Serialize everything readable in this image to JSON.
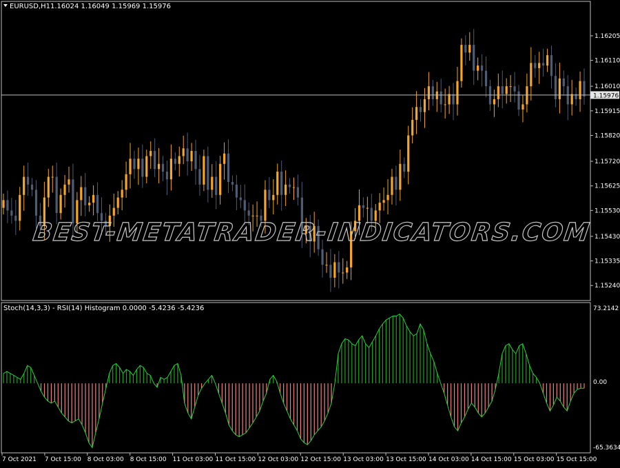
{
  "main_chart": {
    "symbol_label": "EURUSD,H1",
    "ohlc_label": "1.16024 1.16049 1.15969 1.15976",
    "current_price_label": "1.15976",
    "current_price": 1.15976,
    "price_min": 1.1519,
    "price_max": 1.1633,
    "price_ticks": [
      "1.16205",
      "1.16110",
      "1.16010",
      "1.15915",
      "1.15820",
      "1.15720",
      "1.15625",
      "1.15530",
      "1.15430",
      "1.15335",
      "1.15240"
    ]
  },
  "indicator": {
    "title": "Stoch(14,3,3) - RSI(14) Histogram 0.0000 -5.4236 -5.4236",
    "max_label": "73.2142",
    "zero_label": "0.00",
    "min_label": "-65.3634",
    "range_max": 73.2142,
    "range_min": -65.3634
  },
  "time_axis": {
    "labels": [
      "7 Oct 2021",
      "7 Oct 15:00",
      "8 Oct 03:00",
      "8 Oct 15:00",
      "11 Oct 03:00",
      "11 Oct 15:00",
      "12 Oct 03:00",
      "12 Oct 15:00",
      "13 Oct 03:00",
      "13 Oct 15:00",
      "14 Oct 03:00",
      "14 Oct 15:00",
      "15 Oct 03:00",
      "15 Oct 15:00"
    ]
  },
  "watermark": "BEST-METATRADER-INDICATORS.COM",
  "colors": {
    "bull_candle": "#f5a623",
    "bear_candle": "#4e5d73",
    "positive_hist": "#1fa11f",
    "negative_hist": "#f08080",
    "hist_line": "#2ecc40",
    "grid_line": "#c0c0c0"
  },
  "chart_data": {
    "type": "table",
    "candles_close": [
      1.1557,
      1.1553,
      1.1551,
      1.1549,
      1.1559,
      1.1566,
      1.1563,
      1.1561,
      1.1551,
      1.1547,
      1.1558,
      1.1566,
      1.1566,
      1.1552,
      1.1559,
      1.1563,
      1.1565,
      1.1548,
      1.1557,
      1.1562,
      1.1555,
      1.1556,
      1.1559,
      1.1552,
      1.1549,
      1.1547,
      1.1551,
      1.1554,
      1.1558,
      1.1561,
      1.1567,
      1.1573,
      1.1569,
      1.1573,
      1.1566,
      1.1574,
      1.1576,
      1.1569,
      1.1571,
      1.1568,
      1.1565,
      1.1573,
      1.1571,
      1.1574,
      1.1577,
      1.1572,
      1.1576,
      1.1569,
      1.1563,
      1.1574,
      1.1561,
      1.1566,
      1.1559,
      1.1571,
      1.1575,
      1.1564,
      1.1563,
      1.1558,
      1.1557,
      1.1553,
      1.1551,
      1.1551,
      1.1551,
      1.1549,
      1.1561,
      1.1557,
      1.1559,
      1.1568,
      1.1559,
      1.1563,
      1.1562,
      1.1562,
      1.1558,
      1.1544,
      1.1547,
      1.1541,
      1.1547,
      1.1538,
      1.1532,
      1.1532,
      1.1527,
      1.1533,
      1.1529,
      1.1529,
      1.1531,
      1.1545,
      1.1549,
      1.1555,
      1.1554,
      1.1554,
      1.1549,
      1.1553,
      1.1556,
      1.1557,
      1.1559,
      1.1566,
      1.1561,
      1.1571,
      1.1568,
      1.1582,
      1.1588,
      1.1593,
      1.1591,
      1.1596,
      1.1601,
      1.1596,
      1.1599,
      1.1594,
      1.1594,
      1.1598,
      1.1594,
      1.1603,
      1.1617,
      1.1614,
      1.1617,
      1.1607,
      1.1609,
      1.1607,
      1.1601,
      1.1594,
      1.1596,
      1.1601,
      1.1598,
      1.1601,
      1.1601,
      1.1599,
      1.1592,
      1.1594,
      1.1601,
      1.161,
      1.1608,
      1.161,
      1.1609,
      1.1613,
      1.1605,
      1.1596,
      1.1604,
      1.1601,
      1.1594,
      1.1598,
      1.1596,
      1.1603,
      1.1597
    ],
    "histogram": [
      10,
      12,
      10,
      8,
      6,
      4,
      10,
      18,
      16,
      8,
      0,
      -8,
      -14,
      -18,
      -20,
      -18,
      -24,
      -30,
      -34,
      -38,
      -40,
      -38,
      -36,
      -42,
      -50,
      -60,
      -65,
      -50,
      -36,
      -20,
      -5,
      10,
      18,
      20,
      16,
      10,
      14,
      12,
      8,
      14,
      18,
      16,
      10,
      8,
      0,
      -4,
      6,
      4,
      6,
      12,
      18,
      20,
      8,
      -20,
      -30,
      -36,
      -24,
      -12,
      -5,
      0,
      4,
      8,
      0,
      -10,
      -20,
      -30,
      -42,
      -48,
      -52,
      -54,
      -52,
      -50,
      -45,
      -40,
      -34,
      -28,
      -18,
      -10,
      4,
      8,
      2,
      -10,
      -20,
      -28,
      -36,
      -42,
      -48,
      -56,
      -60,
      -62,
      -58,
      -52,
      -48,
      -44,
      -38,
      -30,
      -20,
      0,
      30,
      40,
      45,
      44,
      40,
      38,
      44,
      48,
      40,
      36,
      42,
      48,
      55,
      60,
      64,
      66,
      68,
      68,
      70,
      66,
      58,
      52,
      48,
      50,
      60,
      54,
      40,
      30,
      22,
      10,
      0,
      -10,
      -22,
      -34,
      -44,
      -48,
      -40,
      -34,
      -26,
      -20,
      -24,
      -30,
      -34,
      -30,
      -24,
      -18,
      -6,
      10,
      30,
      38,
      40,
      34,
      30,
      38,
      40,
      30,
      18,
      10,
      6,
      0,
      -10,
      -20,
      -28,
      -22,
      -14,
      -18,
      -24,
      -28,
      -18,
      -10,
      -6,
      -5,
      -5
    ]
  }
}
